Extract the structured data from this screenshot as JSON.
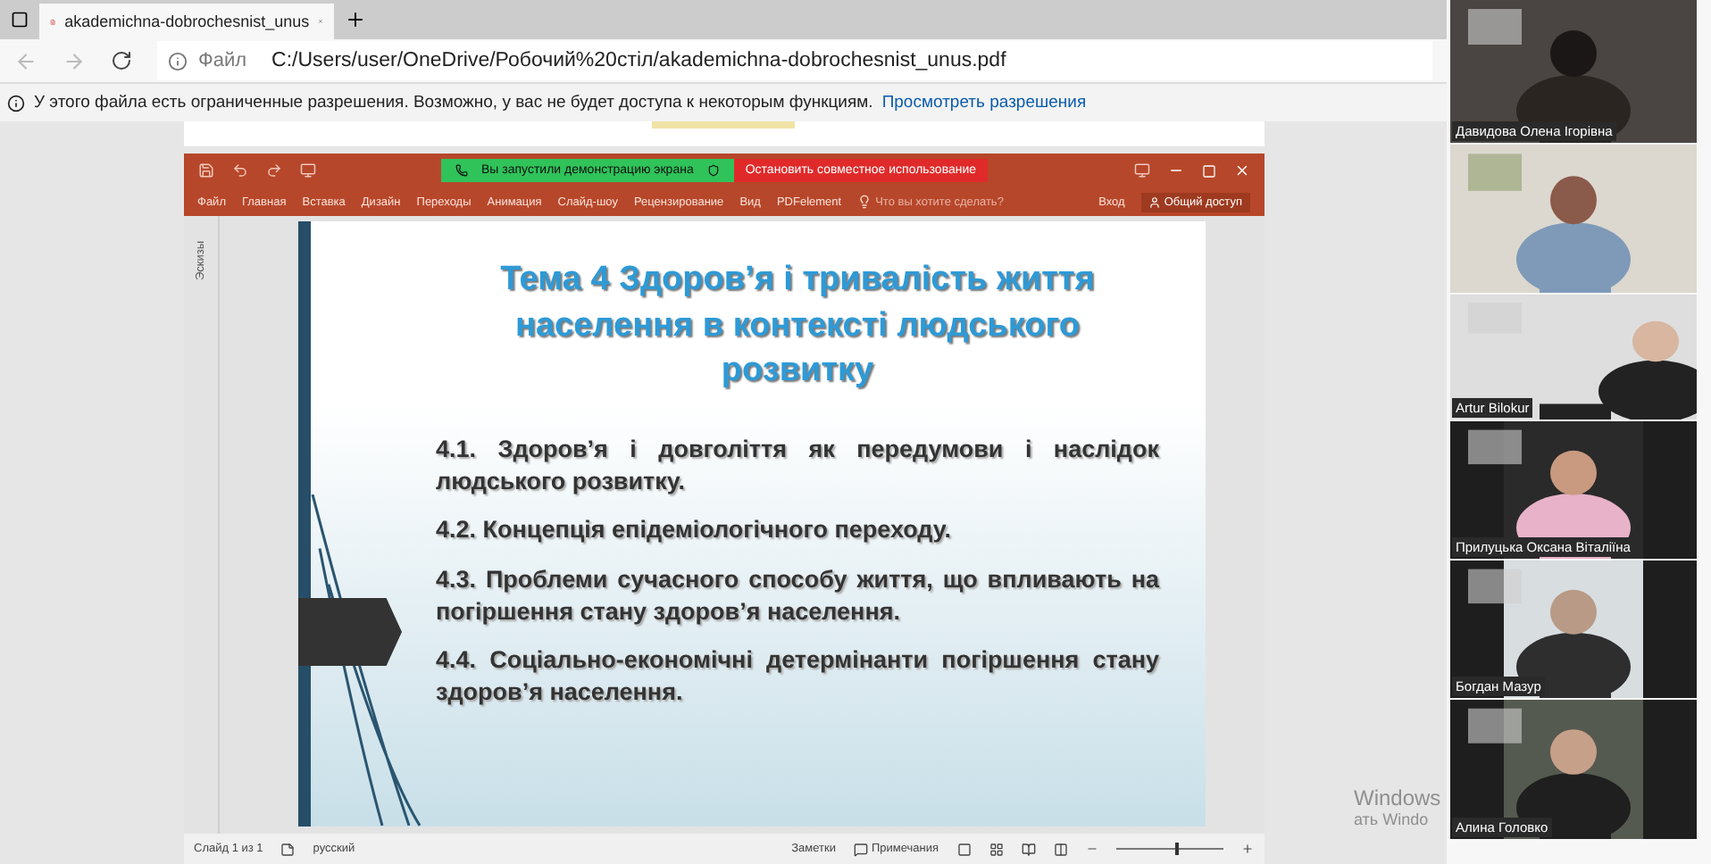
{
  "browser": {
    "tab": {
      "title": "akademichna-dobrochesnist_unus",
      "selected": true
    },
    "address": {
      "scheme": "Файл",
      "url": "C:/Users/user/OneDrive/Робочий%20стіл/akademichna-dobrochesnist_unus.pdf"
    },
    "infobar": {
      "text": "У этого файла есть ограниченные разрешения. Возможно, у вас не будет доступа к некоторым функциям.",
      "link": "Просмотреть разрешения"
    }
  },
  "powerpoint": {
    "share_banner": "Вы запустили демонстрацию экрана",
    "stop_button": "Остановить совместное использование",
    "ribbon_tabs": [
      {
        "label": "Файл",
        "selected": false
      },
      {
        "label": "Главная",
        "selected": false
      },
      {
        "label": "Вставка",
        "selected": false
      },
      {
        "label": "Дизайн",
        "selected": false
      },
      {
        "label": "Переходы",
        "selected": false
      },
      {
        "label": "Анимация",
        "selected": false
      },
      {
        "label": "Слайд-шоу",
        "selected": false
      },
      {
        "label": "Рецензирование",
        "selected": false
      },
      {
        "label": "Вид",
        "selected": false
      },
      {
        "label": "PDFelement",
        "selected": false
      }
    ],
    "tell_me": "Что вы хотите сделать?",
    "sign_in": "Вход",
    "share": "Общий доступ",
    "thumbnails_label": "Эскизы",
    "slide": {
      "title": "Тема 4  Здоров’я і тривалість життя населення в контексті людського розвитку",
      "items": [
        "4.1. Здоров’я і довголіття як передумови і наслідок людського розвитку.",
        "4.2. Концепція епідеміологічного переходу.",
        "4.3. Проблеми сучасного способу життя, що впливають на погіршення стану здоров’я населення.",
        "4.4. Соціально-економічні детермінанти погіршення стану здоров’я населення."
      ]
    },
    "status": {
      "slide": "Слайд 1 из 1",
      "language": "русский",
      "notes": "Заметки",
      "comments": "Примечания",
      "zoom": {
        "level": 0.55
      }
    }
  },
  "activation": {
    "line_1": "Windows",
    "line_2": "ать Windo"
  },
  "participants": [
    {
      "kind": "picture",
      "name": "Давидова Олена Ігорівна"
    },
    {
      "kind": "picture"
    },
    {
      "kind": "picture",
      "name": "Artur Bilokur"
    },
    {
      "kind": "picture",
      "name": "Прилуцька Оксана Віталіїна"
    },
    {
      "kind": "picture",
      "name": "Богдан Мазур"
    },
    {
      "kind": "picture",
      "name": "Алина Головко"
    }
  ]
}
